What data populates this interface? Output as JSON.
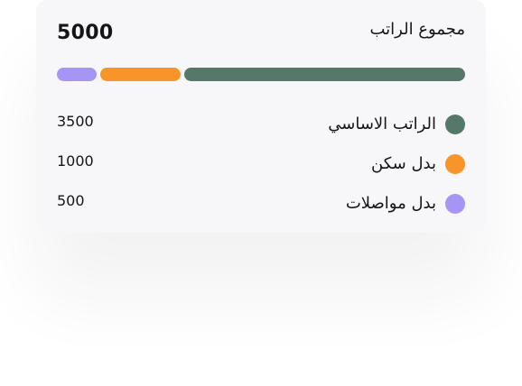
{
  "summary": {
    "title": "مجموع الراتب",
    "total": "5000"
  },
  "breakdown": [
    {
      "label": "الراتب الاساسي",
      "value": "3500",
      "amount": 3500,
      "color": "#56786b"
    },
    {
      "label": "بدل سكن",
      "value": "1000",
      "amount": 1000,
      "color": "#f7952a"
    },
    {
      "label": "بدل مواصلات",
      "value": "500",
      "amount": 500,
      "color": "#a695f5"
    }
  ],
  "colors": {
    "card_background": "#f7f7f9",
    "text": "#151515"
  }
}
